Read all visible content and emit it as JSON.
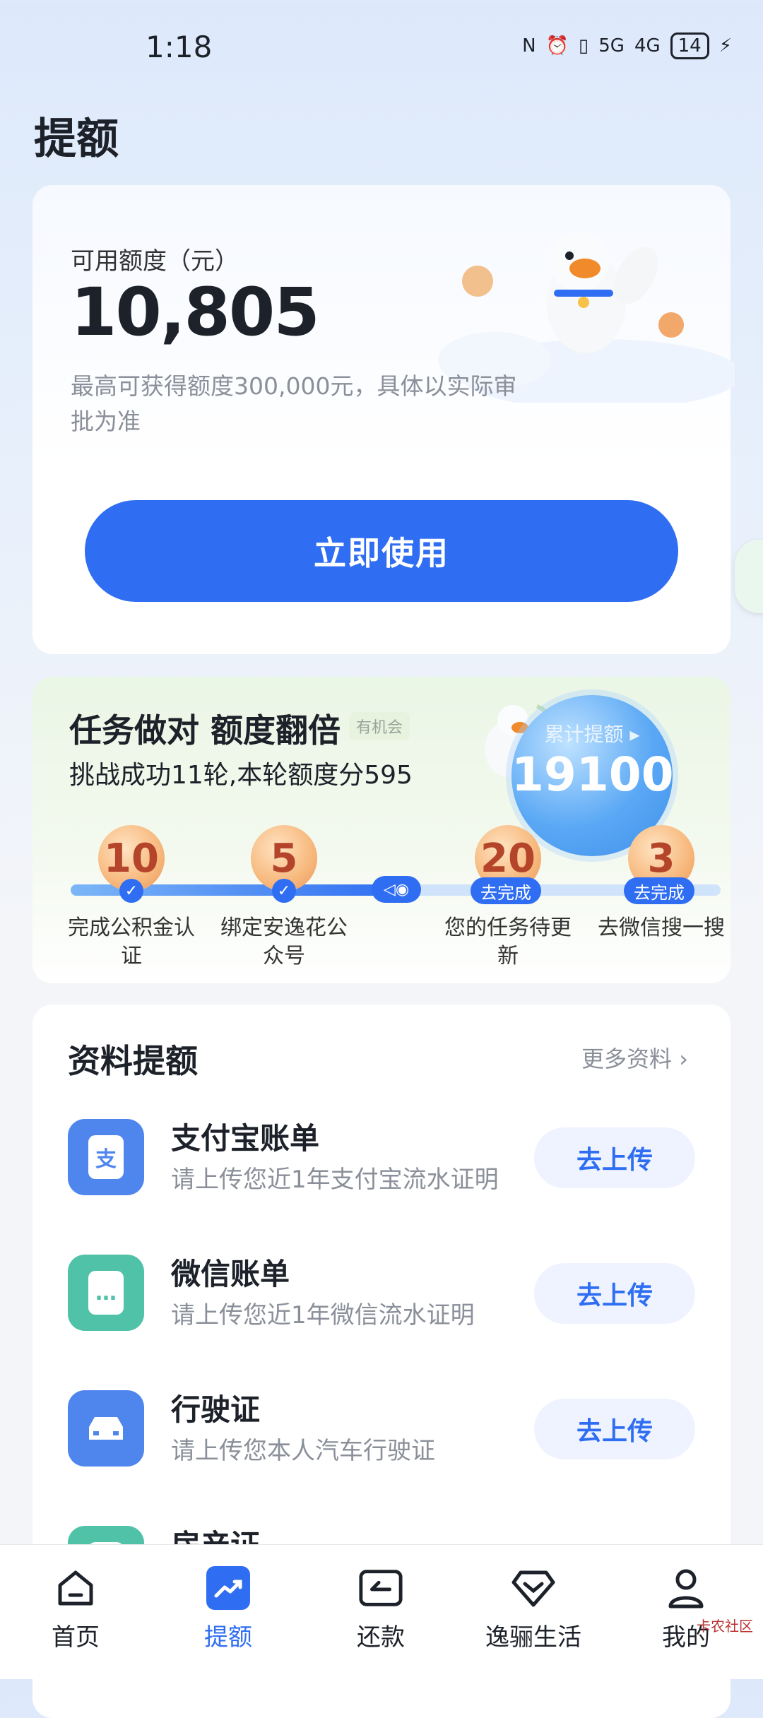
{
  "status_bar": {
    "time": "1:18",
    "nfc": "N",
    "alarm": "⏰",
    "vibrate": "▯",
    "net1": "5G",
    "net2": "4G",
    "battery": "14",
    "charging": "⚡"
  },
  "page": {
    "title": "提额"
  },
  "quota": {
    "label": "可用额度（元）",
    "amount": "10,805",
    "note": "最高可获得额度300,000元，具体以实际审批为准",
    "button": "立即使用"
  },
  "tasks": {
    "title": "任务做对 额度翻倍",
    "tag": "有机会",
    "subtitle": "挑战成功11轮,本轮额度分595",
    "bubble_label": "累计提额 ▸",
    "bubble_value": "19100",
    "progress_done_fraction": 0.5,
    "items": [
      {
        "value": "10",
        "label": "完成公积金认证",
        "done": true,
        "action": ""
      },
      {
        "value": "5",
        "label": "绑定安逸花公众号",
        "done": true,
        "action": ""
      },
      {
        "value": "20",
        "label": "您的任务待更新",
        "done": false,
        "action": "去完成"
      },
      {
        "value": "3",
        "label": "去微信搜一搜",
        "done": false,
        "action": "去完成"
      }
    ]
  },
  "docs": {
    "title": "资料提额",
    "more": "更多资料",
    "items": [
      {
        "name": "支付宝账单",
        "desc": "请上传您近1年支付宝流水证明",
        "button": "去上传",
        "glyph": "支",
        "color": "#4f86ee"
      },
      {
        "name": "微信账单",
        "desc": "请上传您近1年微信流水证明",
        "button": "去上传",
        "glyph": "…",
        "color": "#4fc2a8"
      },
      {
        "name": "行驶证",
        "desc": "请上传您本人汽车行驶证",
        "button": "去上传",
        "glyph": "▬",
        "color": "#4f86ee"
      },
      {
        "name": "房产证",
        "desc": "",
        "button": "",
        "glyph": "▲",
        "color": "#4fc2a8"
      }
    ]
  },
  "nav": {
    "items": [
      {
        "label": "首页"
      },
      {
        "label": "提额"
      },
      {
        "label": "还款"
      },
      {
        "label": "逸骊生活"
      },
      {
        "label": "我的"
      }
    ]
  },
  "watermark": "卡农社区",
  "colors": {
    "primary": "#2f6ef2",
    "coin": "#f7b87c",
    "wechat": "#4fc2a8"
  }
}
